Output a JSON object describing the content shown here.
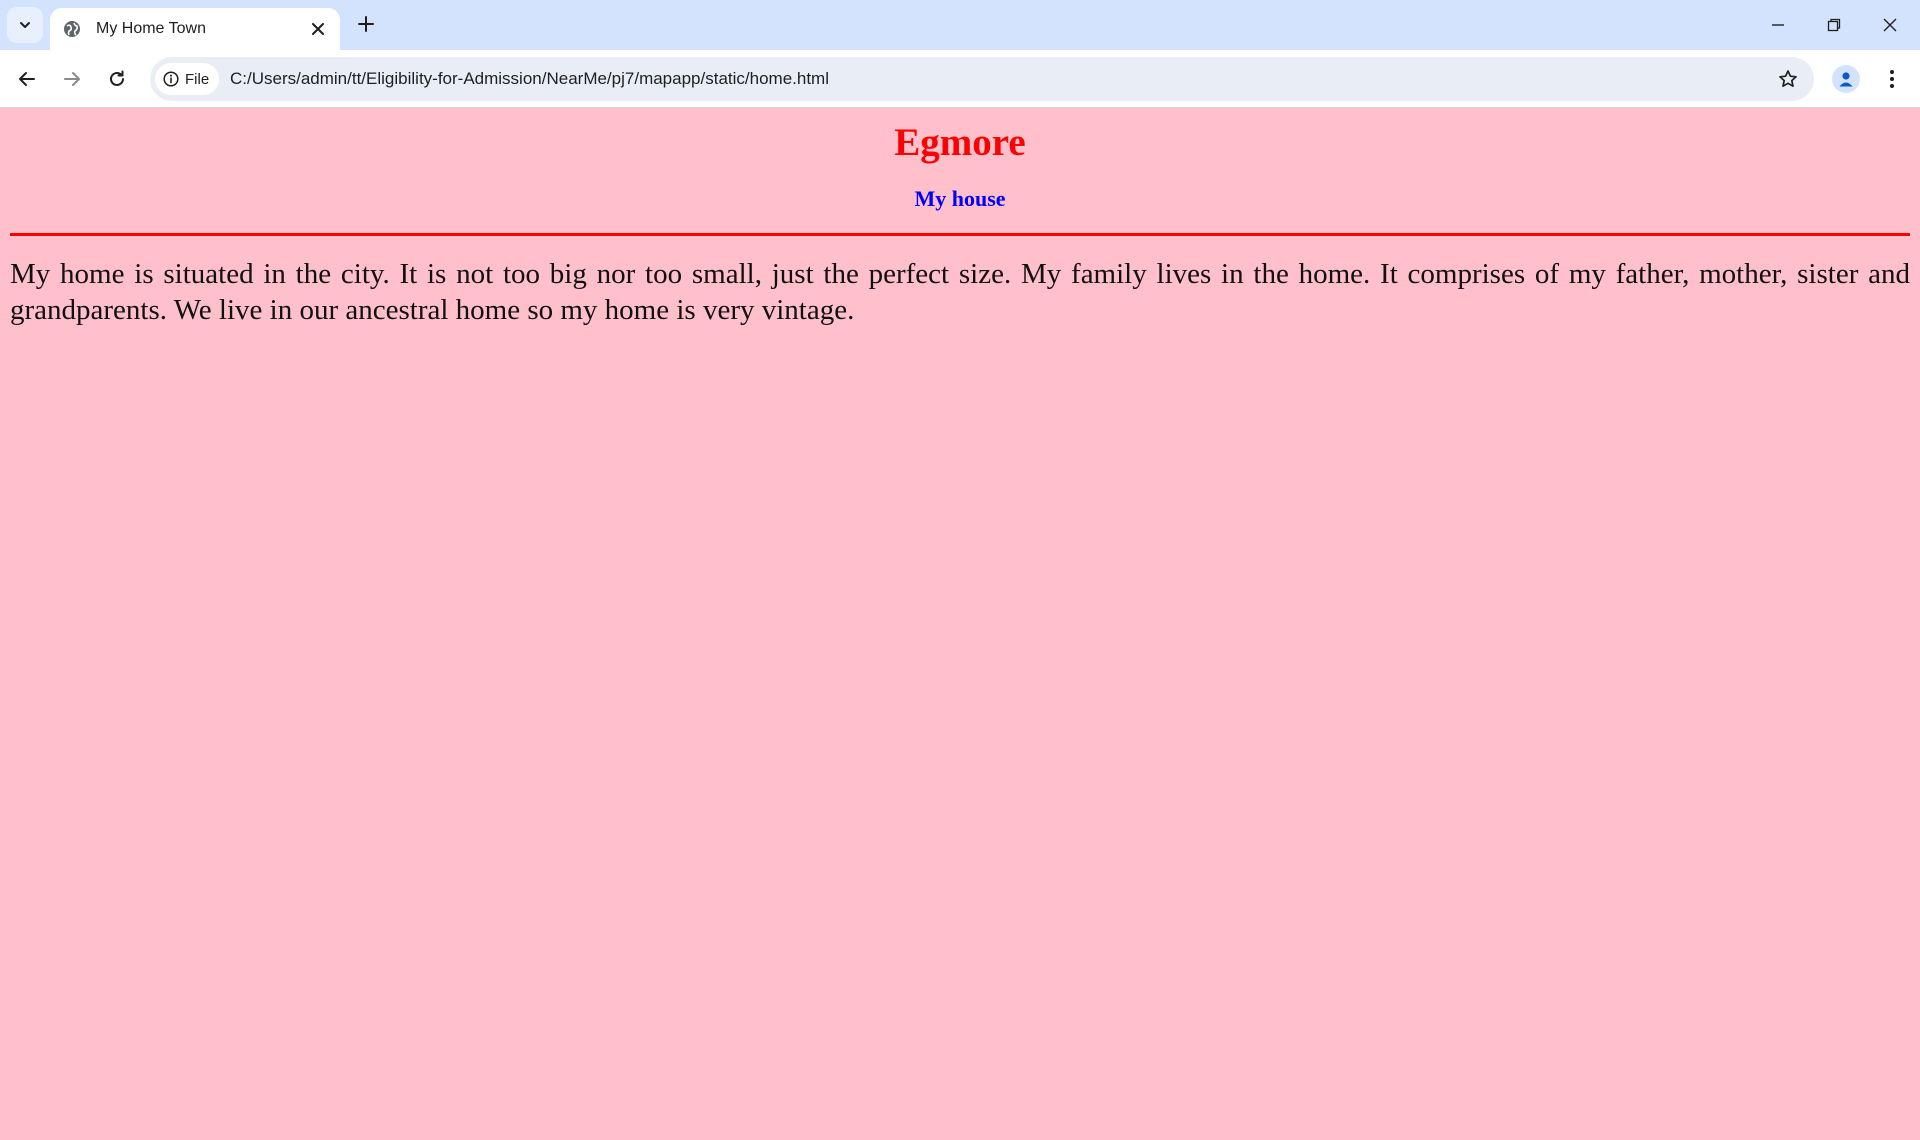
{
  "browser": {
    "tab": {
      "title": "My Home Town"
    },
    "address_bar": {
      "chip_label": "File",
      "url": "C:/Users/admin/tt/Eligibility-for-Admission/NearMe/pj7/mapapp/static/home.html"
    },
    "icons": {
      "tab_search": "chevron-down-icon",
      "favicon": "globe-icon",
      "tab_close": "close-icon",
      "new_tab": "plus-icon",
      "back": "arrow-left-icon",
      "forward": "arrow-right-icon",
      "reload": "reload-icon",
      "site_info": "info-icon",
      "bookmark": "star-icon",
      "profile": "person-icon",
      "menu": "kebab-menu-icon",
      "minimize": "minimize-icon",
      "restore": "restore-icon",
      "close_window": "close-icon"
    }
  },
  "page": {
    "heading": "Egmore",
    "subheading": "My house",
    "paragraph": "My home is situated in the city. It is not too big nor too small, just the perfect size. My family lives in the home. It comprises of my father, mother, sister and grandparents. We live in our ancestral home so my home is very vintage.",
    "colors": {
      "background": "#ffc0cb",
      "heading": "#ff0000",
      "subheading": "#0000ff",
      "divider": "#ff0000",
      "text": "#111111"
    }
  }
}
